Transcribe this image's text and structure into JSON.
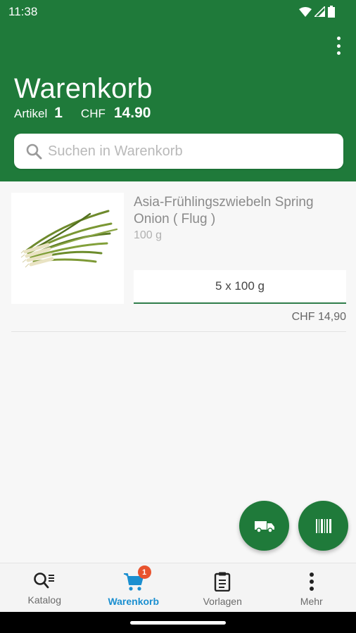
{
  "status": {
    "time": "11:38"
  },
  "header": {
    "title": "Warenkorb",
    "articles_label": "Artikel",
    "articles_count": "1",
    "currency_label": "CHF",
    "total": "14.90"
  },
  "search": {
    "placeholder": "Suchen in Warenkorb"
  },
  "cart": {
    "items": [
      {
        "name": "Asia-Frühlingszwiebeln Spring Onion ( Flug )",
        "unit": "100 g",
        "quantity": "5 x 100 g",
        "price": "CHF 14,90"
      }
    ]
  },
  "fabs": {
    "delivery_icon": "truck-icon",
    "scan_icon": "barcode-icon"
  },
  "nav": {
    "items": [
      {
        "label": "Katalog",
        "icon": "catalog-search-icon"
      },
      {
        "label": "Warenkorb",
        "icon": "cart-icon",
        "badge": "1"
      },
      {
        "label": "Vorlagen",
        "icon": "clipboard-icon"
      },
      {
        "label": "Mehr",
        "icon": "more-vertical-icon"
      }
    ]
  },
  "colors": {
    "primary": "#1f7a3a",
    "active_nav": "#1b8fd0",
    "badge": "#e8532e"
  }
}
